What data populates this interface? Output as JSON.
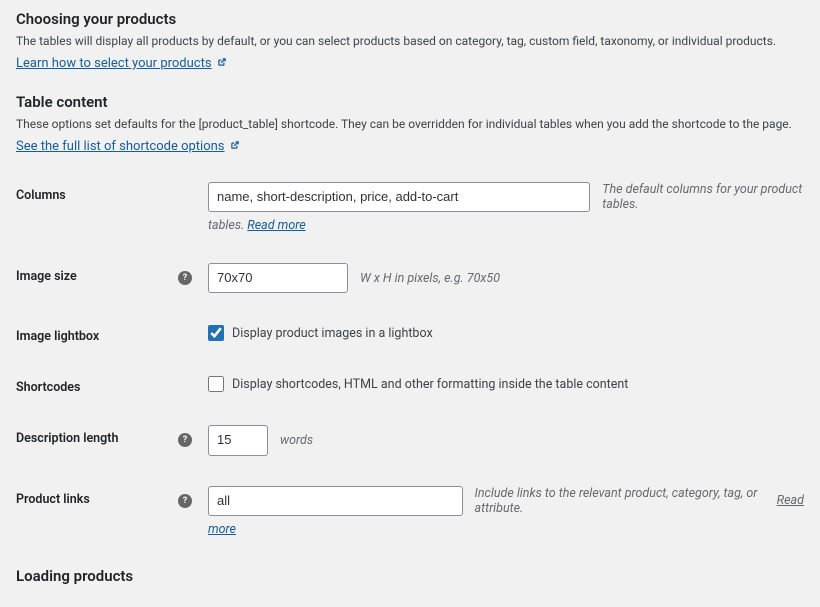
{
  "section1": {
    "heading": "Choosing your products",
    "desc": "The tables will display all products by default, or you can select products based on category, tag, custom field, taxonomy, or individual products.",
    "link": "Learn how to select your products"
  },
  "section2": {
    "heading": "Table content",
    "desc": "These options set defaults for the [product_table] shortcode. They can be overridden for individual tables when you add the shortcode to the page.",
    "link": "See the full list of shortcode options"
  },
  "columns": {
    "label": "Columns",
    "value": "name, short-description, price, add-to-cart",
    "hint1": "The default columns for your product tables. ",
    "read_more": "Read more"
  },
  "image_size": {
    "label": "Image size",
    "value": "70x70",
    "hint": "W x H in pixels, e.g. 70x50"
  },
  "image_lightbox": {
    "label": "Image lightbox",
    "cb_label": "Display product images in a lightbox"
  },
  "shortcodes": {
    "label": "Shortcodes",
    "cb_label": "Display shortcodes, HTML and other formatting inside the table content"
  },
  "desc_len": {
    "label": "Description length",
    "value": "15",
    "hint": "words"
  },
  "product_links": {
    "label": "Product links",
    "value": "all",
    "hint1": "Include links to the relevant product, category, tag, or attribute. ",
    "read_more": "Read more"
  },
  "section3": {
    "heading": "Loading products"
  }
}
